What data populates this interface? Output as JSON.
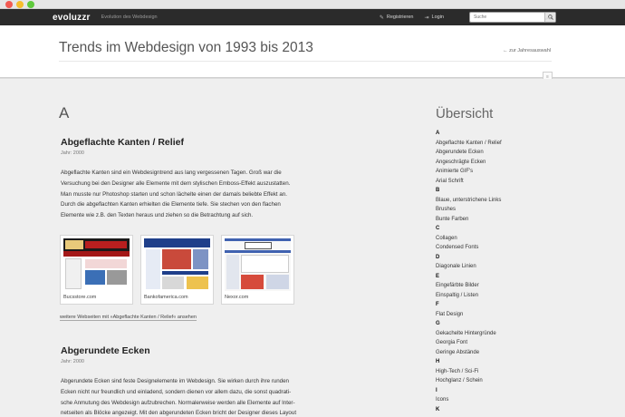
{
  "topbar": {
    "logo": "evoluzzr",
    "tagline": "Evolution des Webdesign",
    "register_label": "Registrieren",
    "login_label": "Login",
    "search_placeholder": "Suche"
  },
  "header": {
    "title": "Trends im Webdesign von 1993 bis 2013",
    "back_link": "← zur Jahresauswahl"
  },
  "main": {
    "letter": "A",
    "entries": [
      {
        "title": "Abgeflachte Kanten / Relief",
        "year": "Jahr: 2000",
        "lines": [
          "Abgeflachte Kanten sind ein Webdesigntrend aus lang vergessenen Tagen. Groß war die",
          "Versuchung bei den Designer alle Elemente mit dem stylischen Emboss-Effekt auszustatten.",
          "Man musste nur Photoshop starten und schon lächelte einen der damals beliebte Effekt an.",
          "Durch die abgeflachten Kanten erhielten die Elemente tiefe. Sie stechen von den flachen",
          "Elemente wie z.B. den Texten heraus und ziehen so die Betrachtung auf sich."
        ],
        "thumbs": [
          {
            "caption": "Bucsstore.com"
          },
          {
            "caption": "Bankofamerica.com"
          },
          {
            "caption": "Nexor.com"
          }
        ],
        "more_link": "weitere Webseiten mit »Abgeflachte Kanten / Relief« ansehen"
      },
      {
        "title": "Abgerundete Ecken",
        "year": "Jahr: 2000",
        "lines": [
          "Abgerundete Ecken sind feste Designelemente im Webdesign. Sie wirken durch ihre runden",
          "Ecken nicht nur freundlich und einladend, sondern dienen vor allem dazu, die sonst quadrati-",
          "sche Anmutung des Webdesign aufzubrechen. Normalerweise werden alle Elemente auf Inter-",
          "netseiten als Blöcke angezeigt. Mit den abgerundeten Ecken bricht der Designer dieses Layout"
        ]
      }
    ]
  },
  "sidebar": {
    "title": "Übersicht",
    "rows": [
      {
        "text": "A",
        "letter": true
      },
      {
        "text": "Abgeflachte Kanten / Relief"
      },
      {
        "text": "Abgerundete Ecken"
      },
      {
        "text": "Angeschrägte Ecken"
      },
      {
        "text": "Animierte GIF's"
      },
      {
        "text": "Arial Schrift"
      },
      {
        "text": "B",
        "letter": true
      },
      {
        "text": "Blaue, unterstrichene Links"
      },
      {
        "text": "Brushes"
      },
      {
        "text": "Bunte Farben"
      },
      {
        "text": "C",
        "letter": true
      },
      {
        "text": "Collagen"
      },
      {
        "text": "Condensed Fonts"
      },
      {
        "text": "D",
        "letter": true
      },
      {
        "text": "Diagonale Linien"
      },
      {
        "text": "E",
        "letter": true
      },
      {
        "text": "Eingefärbte Bilder"
      },
      {
        "text": "Einspaltig / Listen"
      },
      {
        "text": "F",
        "letter": true
      },
      {
        "text": "Flat Design"
      },
      {
        "text": "G",
        "letter": true
      },
      {
        "text": "Gekachelte Hintergründe"
      },
      {
        "text": "Georgia Font"
      },
      {
        "text": "Geringe Abstände"
      },
      {
        "text": "H",
        "letter": true
      },
      {
        "text": "High-Tech / Sci-Fi"
      },
      {
        "text": "Hochglanz / Schein"
      },
      {
        "text": "I",
        "letter": true
      },
      {
        "text": "Icons"
      },
      {
        "text": "K",
        "letter": true
      }
    ]
  }
}
